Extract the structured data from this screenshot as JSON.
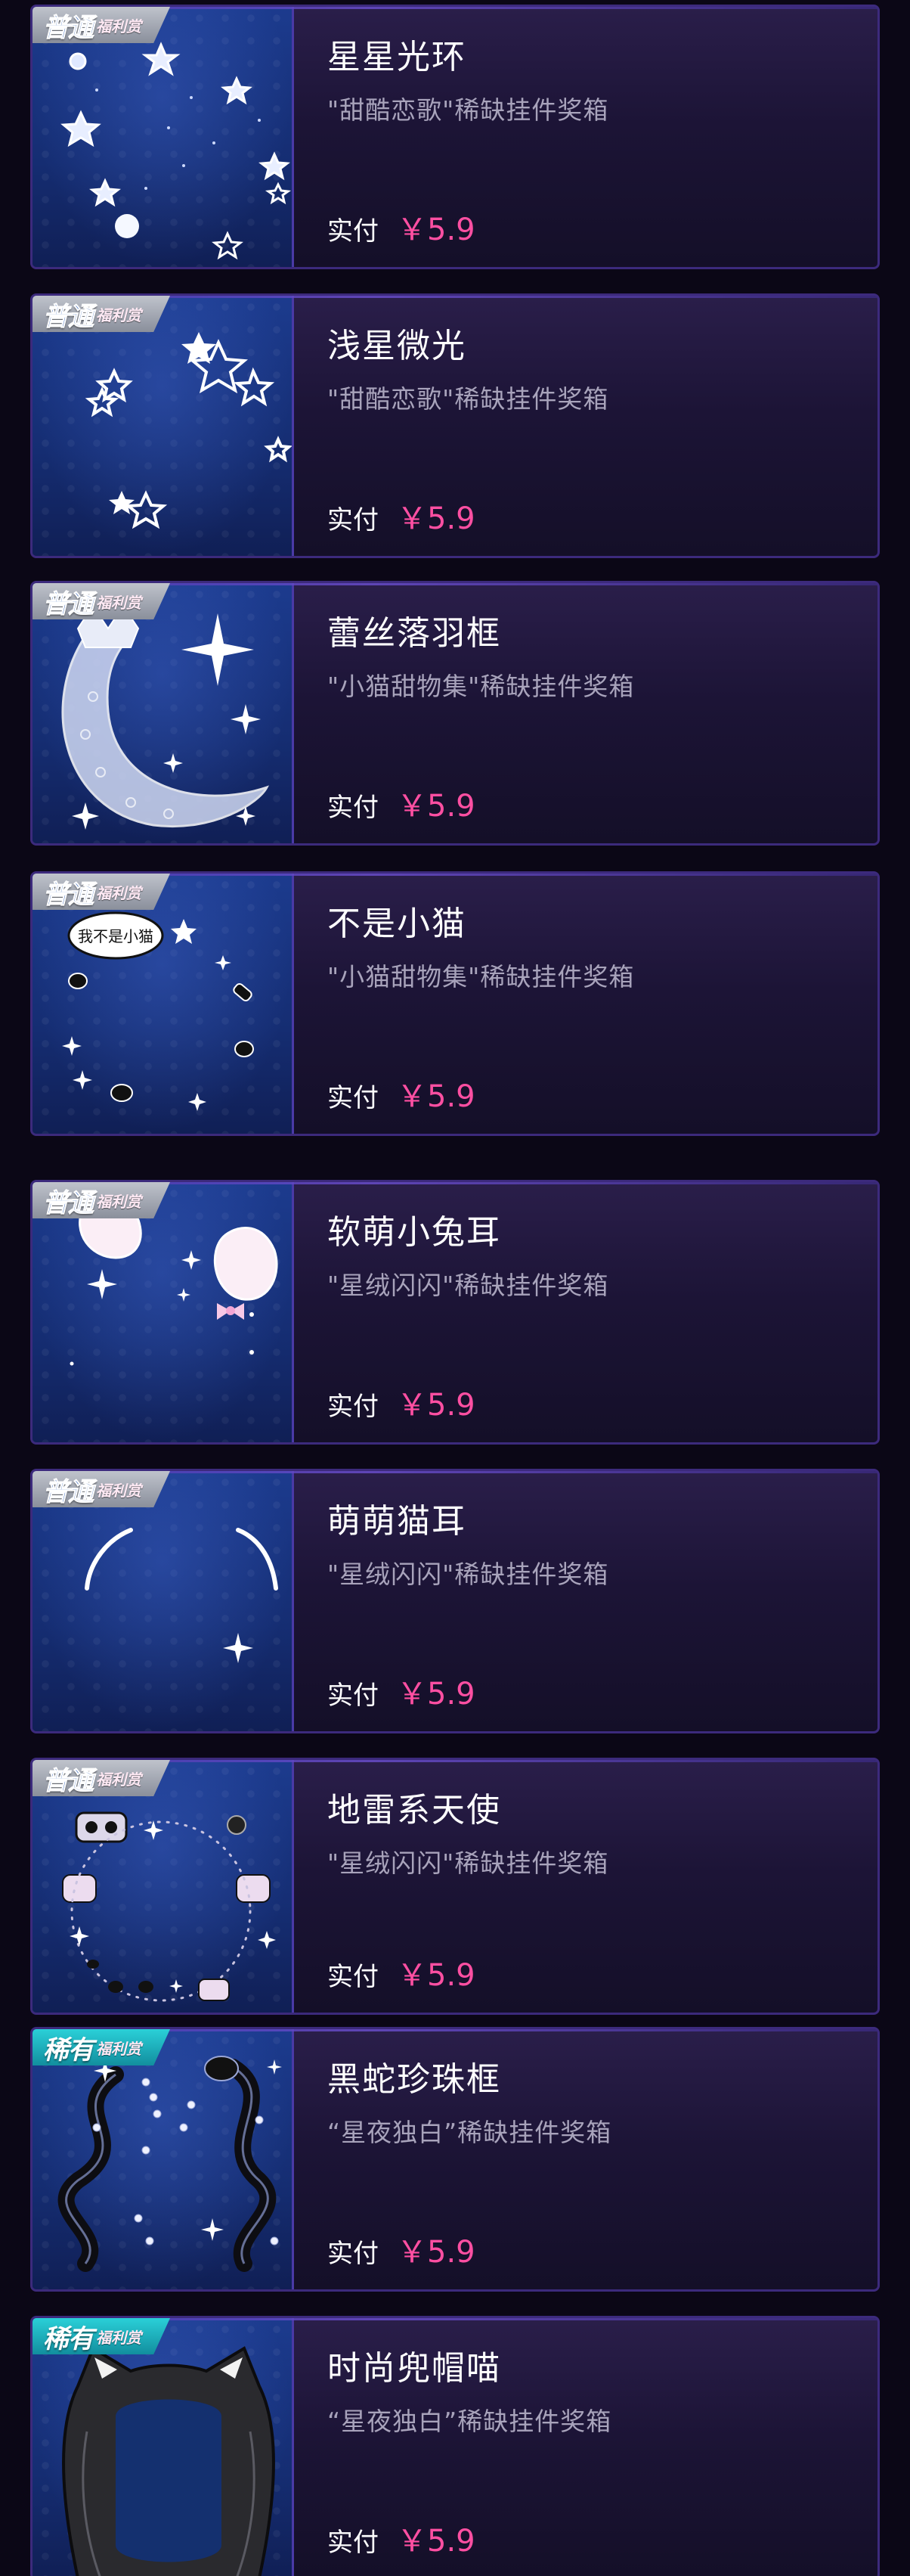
{
  "colors": {
    "price": "#ff4fa2",
    "card_border": "#3c2a7c",
    "common_badge": "#a8acb6",
    "rare_badge": "#1fb6c2"
  },
  "items": [
    {
      "badge_tier": "普通",
      "badge_tag": "福利赏",
      "badge_type": "common",
      "title": "星星光环",
      "subtitle": "\"甜酷恋歌\"稀缺挂件奖箱",
      "price_label": "实付",
      "price": "￥5.9",
      "art": "star-halo-art"
    },
    {
      "badge_tier": "普通",
      "badge_tag": "福利赏",
      "badge_type": "common",
      "title": "浅星微光",
      "subtitle": "\"甜酷恋歌\"稀缺挂件奖箱",
      "price_label": "实付",
      "price": "￥5.9",
      "art": "faint-stars-art"
    },
    {
      "badge_tier": "普通",
      "badge_tag": "福利赏",
      "badge_type": "common",
      "title": "蕾丝落羽框",
      "subtitle": "\"小猫甜物集\"稀缺挂件奖箱",
      "price_label": "实付",
      "price": "￥5.9",
      "art": "lace-moon-art"
    },
    {
      "badge_tier": "普通",
      "badge_tag": "福利赏",
      "badge_type": "common",
      "title": "不是小猫",
      "subtitle": "\"小猫甜物集\"稀缺挂件奖箱",
      "price_label": "实付",
      "price": "￥5.9",
      "art": "paws-art",
      "art_text": "我不是小猫"
    },
    {
      "badge_tier": "普通",
      "badge_tag": "福利赏",
      "badge_type": "common",
      "title": "软萌小兔耳",
      "subtitle": "\"星绒闪闪\"稀缺挂件奖箱",
      "price_label": "实付",
      "price": "￥5.9",
      "art": "bunny-ears-art"
    },
    {
      "badge_tier": "普通",
      "badge_tag": "福利赏",
      "badge_type": "common",
      "title": "萌萌猫耳",
      "subtitle": "\"星绒闪闪\"稀缺挂件奖箱",
      "price_label": "实付",
      "price": "￥5.9",
      "art": "cat-ears-art"
    },
    {
      "badge_tier": "普通",
      "badge_tag": "福利赏",
      "badge_type": "common",
      "title": "地雷系天使",
      "subtitle": "\"星绒闪闪\"稀缺挂件奖箱",
      "price_label": "实付",
      "price": "￥5.9",
      "art": "angel-ring-art"
    },
    {
      "badge_tier": "稀有",
      "badge_tag": "福利赏",
      "badge_type": "rare",
      "title": "黑蛇珍珠框",
      "subtitle": "“星夜独白”稀缺挂件奖箱",
      "price_label": "实付",
      "price": "￥5.9",
      "art": "snake-pearl-art"
    },
    {
      "badge_tier": "稀有",
      "badge_tag": "福利赏",
      "badge_type": "rare",
      "title": "时尚兜帽喵",
      "subtitle": "“星夜独白”稀缺挂件奖箱",
      "price_label": "实付",
      "price": "￥5.9",
      "art": "cat-hood-art"
    }
  ]
}
